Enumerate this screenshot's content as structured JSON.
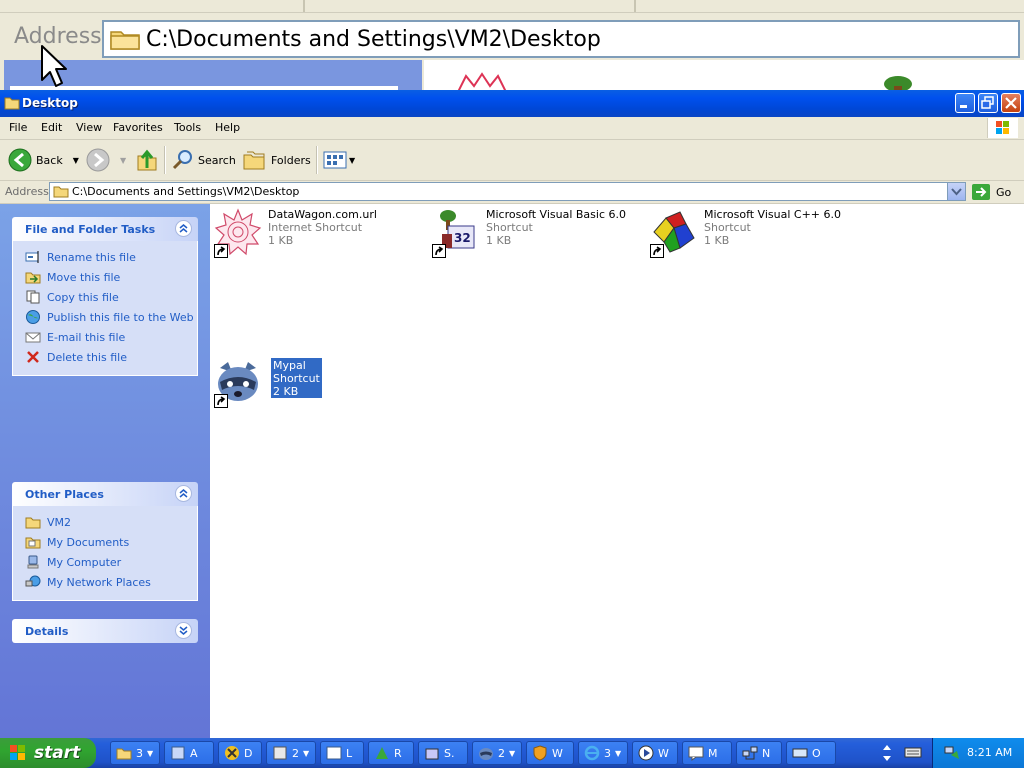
{
  "background": {
    "address_label": "Address",
    "address_path": "C:\\Documents and Settings\\VM2\\Desktop"
  },
  "window": {
    "title": "Desktop",
    "menu": [
      "File",
      "Edit",
      "View",
      "Favorites",
      "Tools",
      "Help"
    ],
    "toolbar": {
      "back": "Back",
      "search": "Search",
      "folders": "Folders"
    },
    "address": {
      "label": "Address",
      "value": "C:\\Documents and Settings\\VM2\\Desktop",
      "go": "Go"
    },
    "task_pane": {
      "file_tasks": {
        "title": "File and Folder Tasks",
        "items": [
          "Rename this file",
          "Move this file",
          "Copy this file",
          "Publish this file to the Web",
          "E-mail this file",
          "Delete this file"
        ]
      },
      "other_places": {
        "title": "Other Places",
        "items": [
          "VM2",
          "My Documents",
          "My Computer",
          "My Network Places"
        ]
      },
      "details": {
        "title": "Details"
      }
    },
    "files": [
      {
        "name": "DataWagon.com.url",
        "type": "Internet Shortcut",
        "size": "1 KB"
      },
      {
        "name": "Microsoft Visual Basic 6.0",
        "type": "Shortcut",
        "size": "1 KB"
      },
      {
        "name": "Microsoft Visual C++ 6.0",
        "type": "Shortcut",
        "size": "1 KB"
      },
      {
        "name": "Mypal",
        "type": "Shortcut",
        "size": "2 KB",
        "selected": true
      }
    ]
  },
  "taskbar": {
    "start": "start",
    "buttons": [
      "3",
      "A",
      "D",
      "2",
      "L",
      "R",
      "S.",
      "2",
      "W",
      "3",
      "W",
      "M",
      "N",
      "O"
    ],
    "clock": "8:21 AM"
  },
  "colors": {
    "titlebar": "#0050ee",
    "task_pane": "#6d8de3",
    "link": "#215dc6",
    "selection": "#316ac5",
    "taskbar": "#245edb",
    "start": "#30a530"
  }
}
